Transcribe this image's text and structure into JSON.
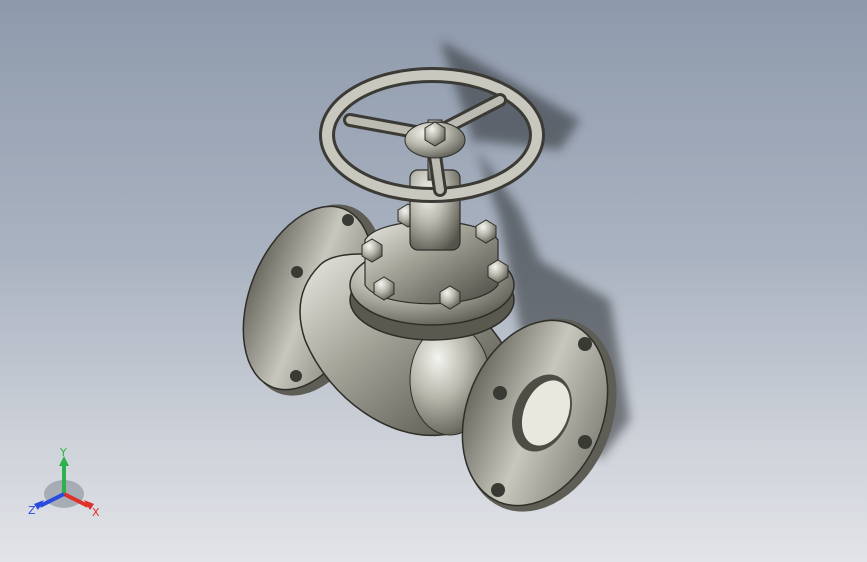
{
  "viewport": {
    "model": "globe-valve",
    "background_top": "#8e9aac",
    "background_bottom": "#e2e4e8"
  },
  "triad": {
    "x_label": "X",
    "y_label": "Y",
    "z_label": "Z",
    "x_color": "#e0302a",
    "y_color": "#2bb34a",
    "z_color": "#2a4be0"
  }
}
